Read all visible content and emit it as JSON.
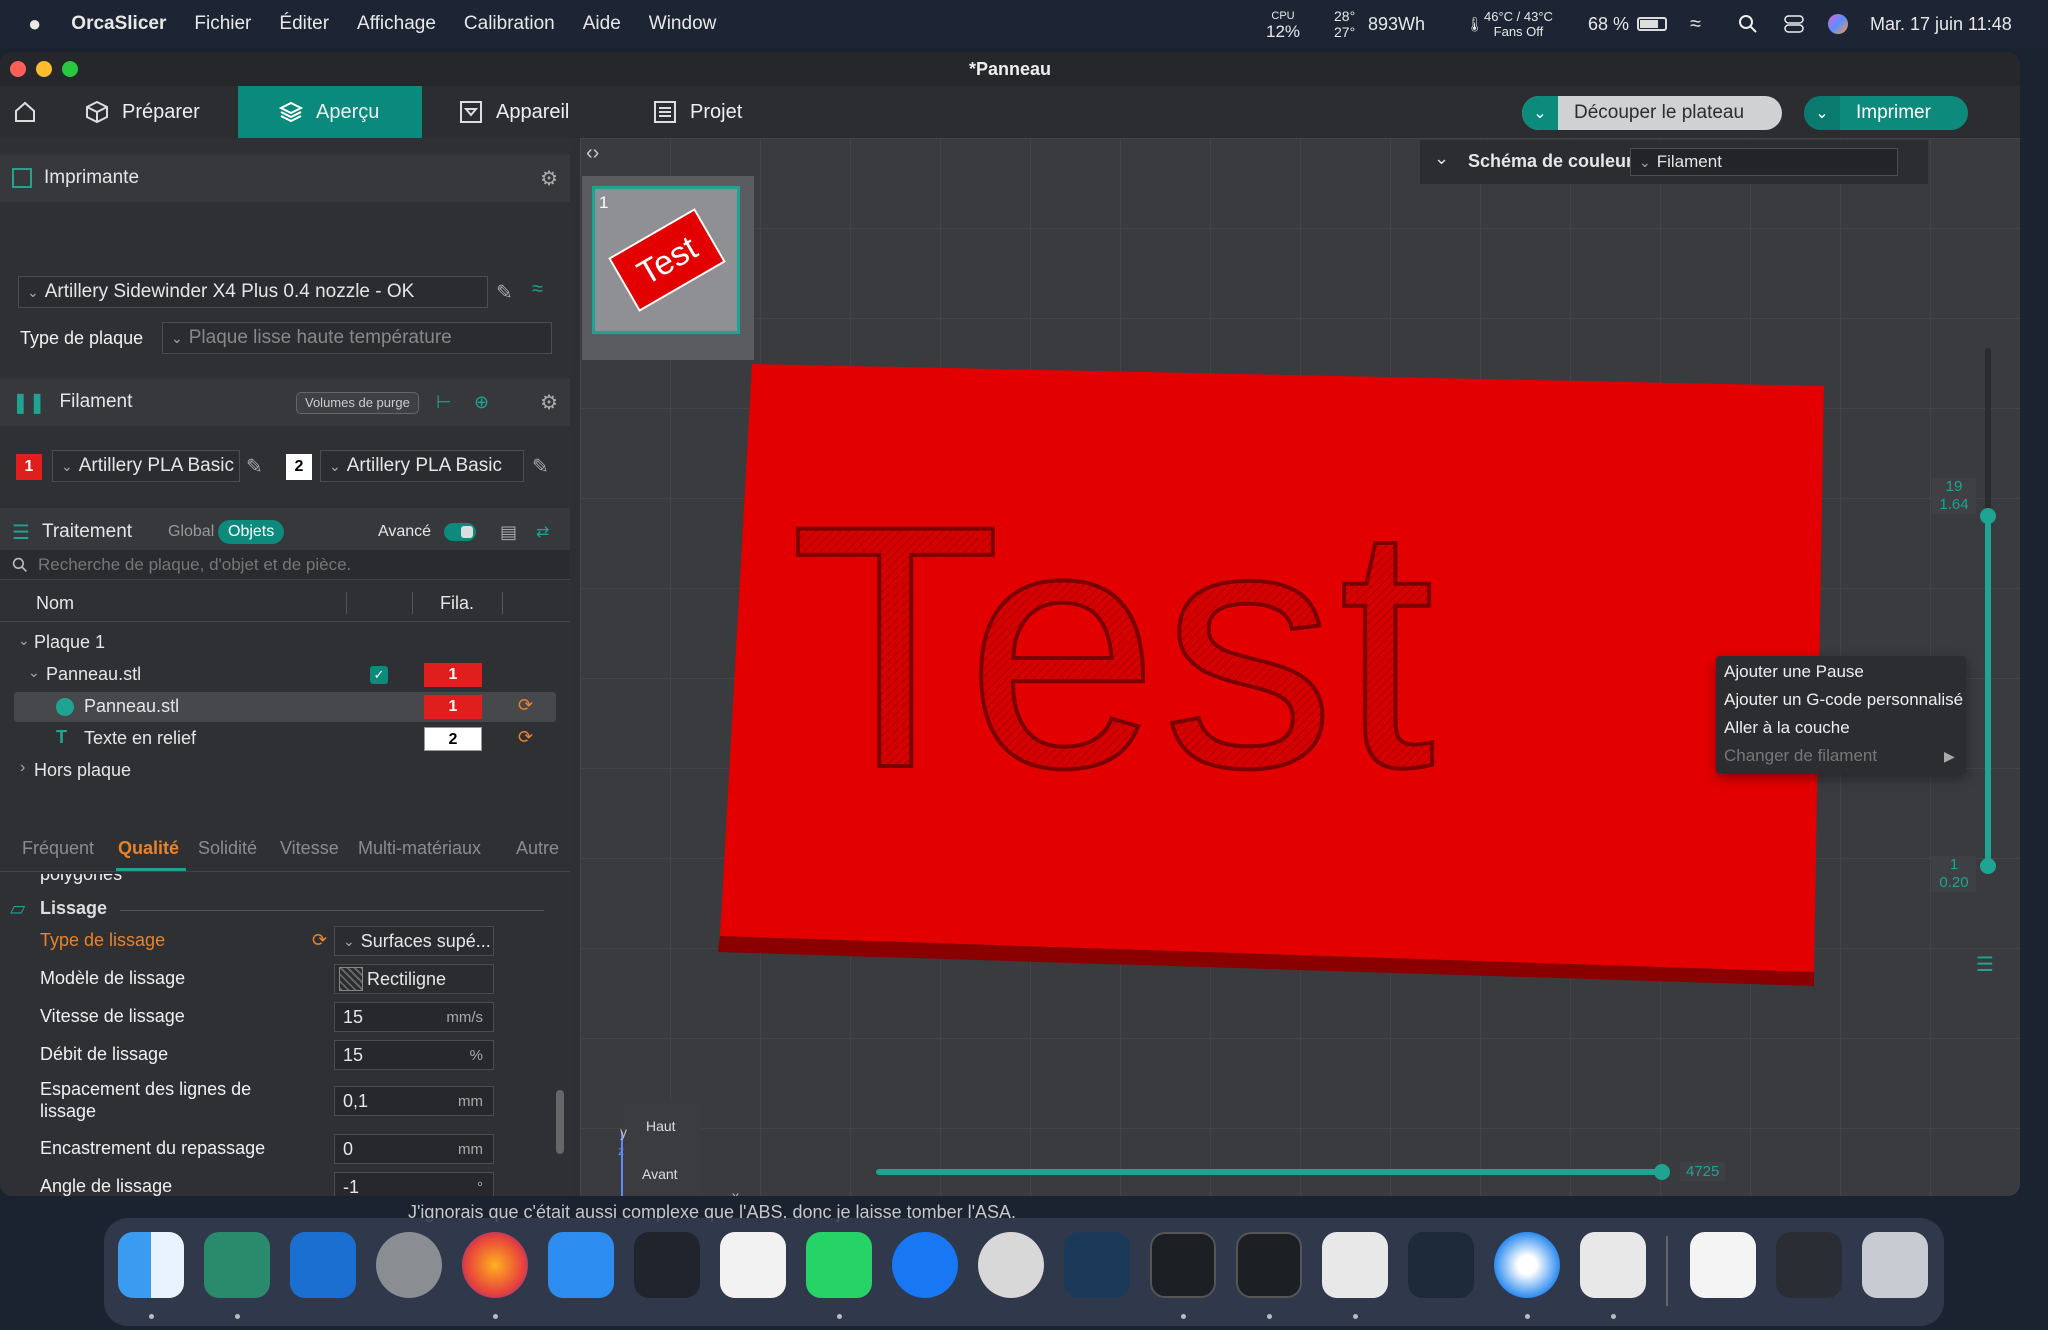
{
  "menubar": {
    "app_name": "OrcaSlicer",
    "menus": [
      "Fichier",
      "Éditer",
      "Affichage",
      "Calibration",
      "Aide",
      "Window"
    ],
    "cpu_label": "CPU",
    "cpu_value": "12%",
    "temps_top": "28°",
    "temps_bottom": "27°",
    "energy": "893Wh",
    "fan_top": "46°C / 43°C",
    "fan_bottom": "Fans Off",
    "battery": "68 %",
    "datetime": "Mar. 17 juin  11:48"
  },
  "window": {
    "title": "*Panneau"
  },
  "toolbar": {
    "tabs": [
      {
        "label": "Préparer"
      },
      {
        "label": "Aperçu"
      },
      {
        "label": "Appareil"
      },
      {
        "label": "Projet"
      }
    ],
    "slice_label": "Découper le plateau",
    "print_label": "Imprimer"
  },
  "printer": {
    "section_title": "Imprimante",
    "printer_name": "Artillery Sidewinder X4 Plus 0.4 nozzle - OK",
    "plate_type_label": "Type de plaque",
    "plate_type_value": "Plaque lisse haute température"
  },
  "filament": {
    "section_title": "Filament",
    "purge_label": "Volumes de purge",
    "items": [
      {
        "index": "1",
        "name": "Artillery PLA Basic",
        "color": "#e01e1e"
      },
      {
        "index": "2",
        "name": "Artillery PLA Basic",
        "color": "#ffffff"
      }
    ]
  },
  "process": {
    "section_title": "Traitement",
    "global_label": "Global",
    "objects_label": "Objets",
    "advanced_label": "Avancé",
    "search_placeholder": "Recherche de plaque, d'objet et de pièce.",
    "col_name": "Nom",
    "col_fila": "Fila.",
    "tree": [
      {
        "label": "Plaque 1"
      },
      {
        "label": "Panneau.stl",
        "fila": "1"
      },
      {
        "label": "Panneau.stl",
        "fila": "1"
      },
      {
        "label": "Texte en relief",
        "fila": "2"
      },
      {
        "label": "Hors plaque"
      }
    ]
  },
  "settings": {
    "tabs": [
      "Fréquent",
      "Qualité",
      "Solidité",
      "Vitesse",
      "Multi-matériaux",
      "Autre"
    ],
    "partial_label": "polygones",
    "group_title": "Lissage",
    "rows": [
      {
        "label": "Type de lissage",
        "value": "Surfaces supé...",
        "unit": ""
      },
      {
        "label": "Modèle de lissage",
        "value": "Rectiligne",
        "unit": ""
      },
      {
        "label": "Vitesse de lissage",
        "value": "15",
        "unit": "mm/s"
      },
      {
        "label": "Débit de lissage",
        "value": "15",
        "unit": "%"
      },
      {
        "label": "Espacement des lignes de lissage",
        "value": "0,1",
        "unit": "mm"
      },
      {
        "label": "Encastrement du repassage",
        "value": "0",
        "unit": "mm"
      },
      {
        "label": "Angle de lissage",
        "value": "-1",
        "unit": "°"
      }
    ]
  },
  "viewport": {
    "plate_number": "1",
    "thumb_text": "Test",
    "model_text": "Test",
    "color_scheme_label": "Schéma de couleur",
    "color_scheme_value": "Filament",
    "layer_top_num": "19",
    "layer_top_height": "1.64",
    "layer_bottom_num": "1",
    "layer_bottom_height": "0.20",
    "horizontal_value": "4725",
    "view_top": "Haut",
    "view_front": "Avant",
    "axis_x": "x",
    "axis_y": "y",
    "axis_z": "z",
    "context_menu": [
      "Ajouter une Pause",
      "Ajouter un G-code personnalisé",
      "Aller à la couche",
      "Changer de filament"
    ]
  },
  "background_caption": "J'ignorais que c'était aussi complexe que l'ABS, donc je laisse tomber l'ASA."
}
